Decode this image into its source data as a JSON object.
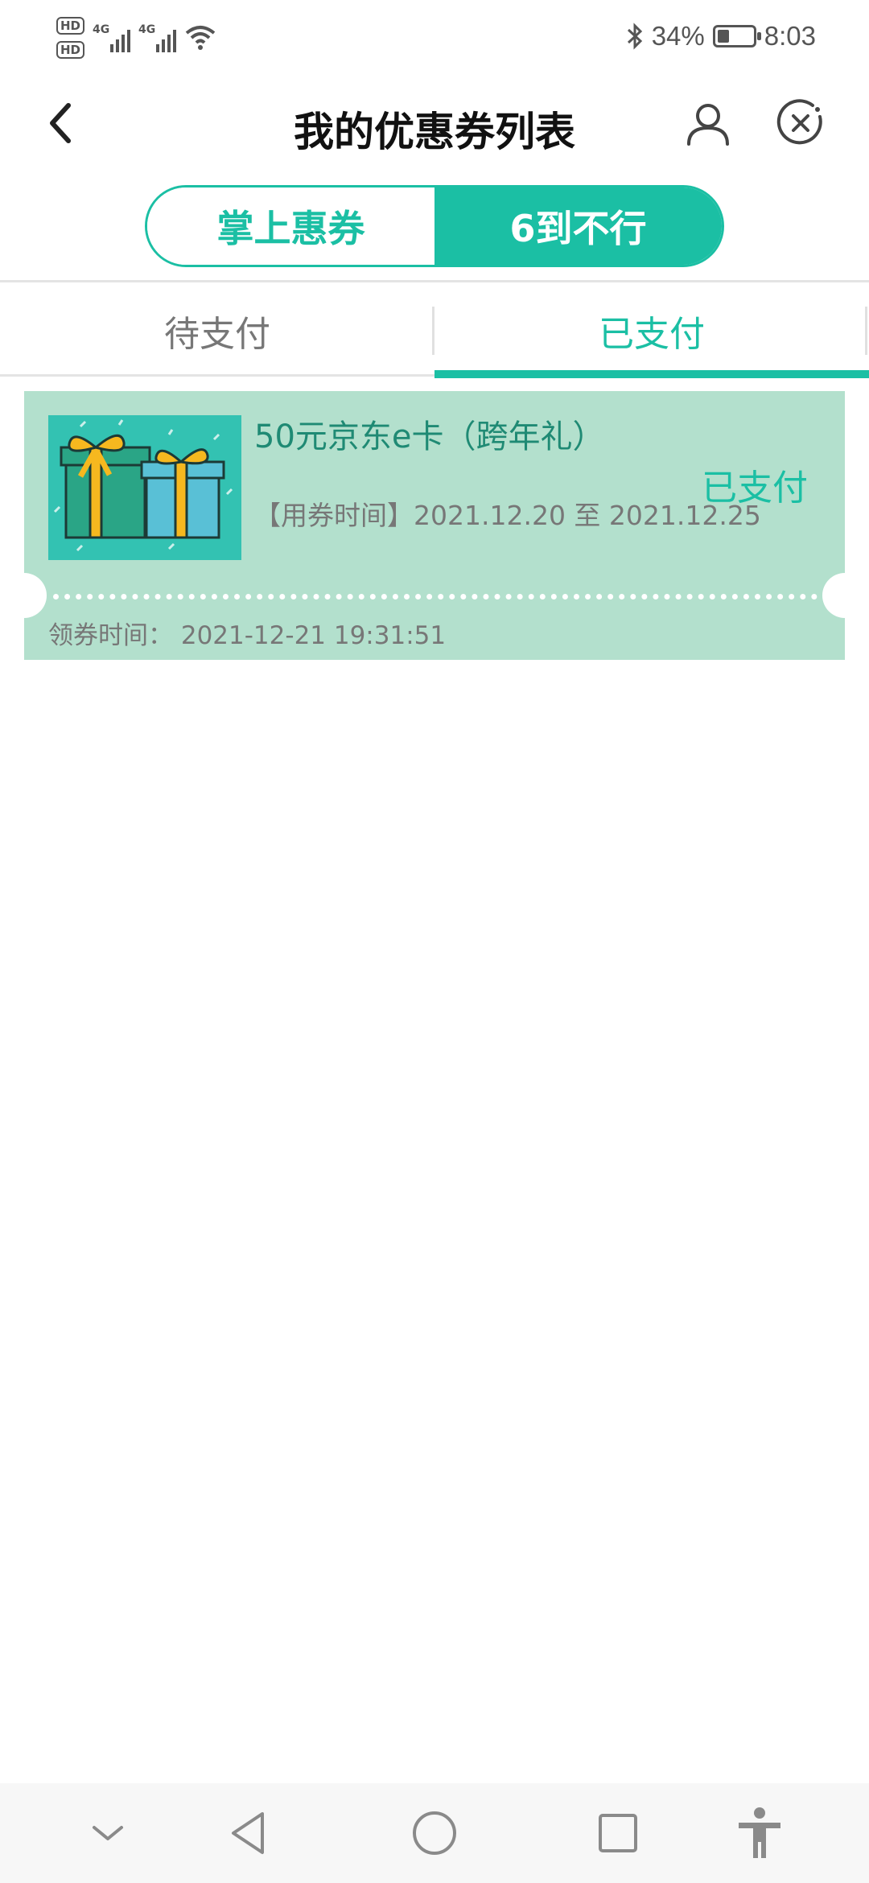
{
  "status_bar": {
    "sim1": "HD",
    "sim2": "HD",
    "network1": "4G",
    "network2": "4G",
    "battery_percent": "34%",
    "battery_level": 0.34,
    "time": "8:03"
  },
  "header": {
    "title": "我的优惠券列表"
  },
  "segment": {
    "items": [
      {
        "label": "掌上惠券",
        "active": false
      },
      {
        "label": "6到不行",
        "active": true
      }
    ]
  },
  "tabs": {
    "items": [
      {
        "label": "待支付",
        "active": false
      },
      {
        "label": "已支付",
        "active": true
      }
    ]
  },
  "coupons": [
    {
      "name": "50元京东e卡（跨年礼）",
      "status": "已支付",
      "use_time": "【用券时间】2021.12.20 至 2021.12.25",
      "receive_time": "领券时间： 2021-12-21 19:31:51"
    }
  ],
  "colors": {
    "accent": "#1bbfa4",
    "card_bg": "#b3e0cd"
  },
  "icons": [
    "back-icon",
    "user-icon",
    "close-circle-icon",
    "nav-down-icon",
    "nav-back-icon",
    "nav-home-icon",
    "nav-recents-icon",
    "accessibility-icon"
  ]
}
